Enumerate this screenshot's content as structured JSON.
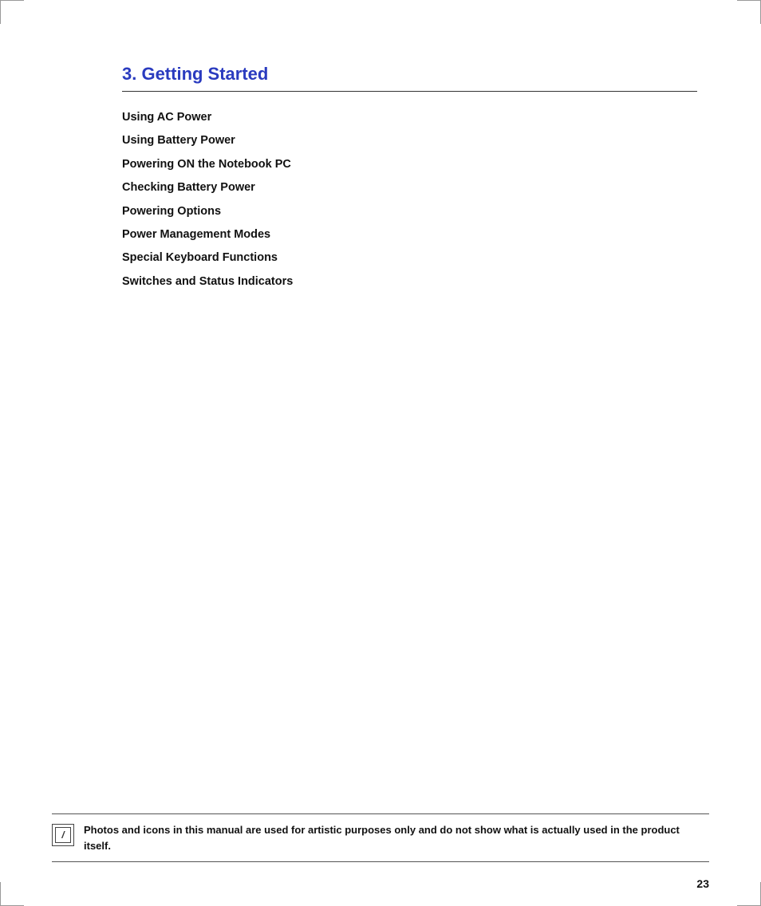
{
  "corners": {
    "top_left": true,
    "top_right": true,
    "bottom_left": true,
    "bottom_right": true
  },
  "chapter": {
    "title": "3. Getting Started",
    "accent_color": "#2a3bbf"
  },
  "toc": {
    "items": [
      {
        "label": "Using AC Power"
      },
      {
        "label": "Using Battery Power"
      },
      {
        "label": "Powering ON the Notebook PC"
      },
      {
        "label": "Checking Battery Power"
      },
      {
        "label": "Powering Options"
      },
      {
        "label": "Power Management Modes"
      },
      {
        "label": "Special Keyboard Functions"
      },
      {
        "label": "Switches and Status Indicators"
      }
    ]
  },
  "note": {
    "icon_symbol": "∕",
    "text": "Photos and icons in this manual are used for artistic purposes only and do not show what is actually used in the product itself."
  },
  "page": {
    "number": "23"
  }
}
